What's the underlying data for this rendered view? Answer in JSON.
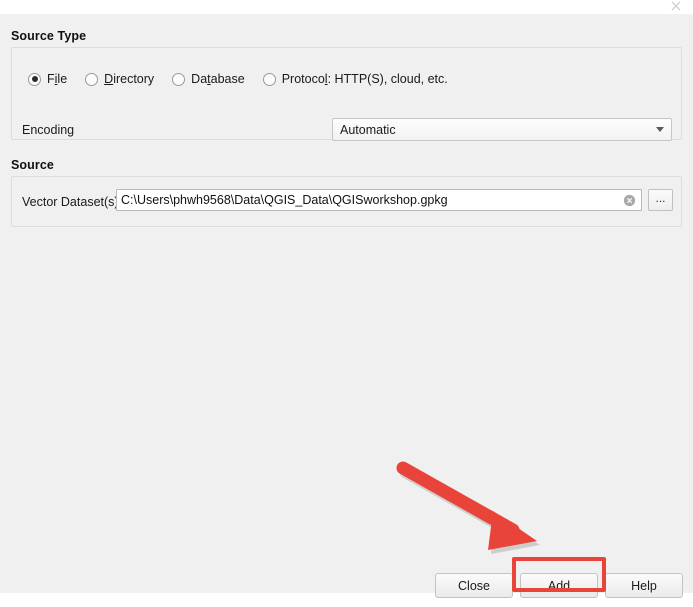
{
  "window": {
    "close_icon": "close-icon"
  },
  "source_type": {
    "title": "Source Type",
    "options": [
      {
        "label": "File",
        "mnemonic_index": 1,
        "checked": true
      },
      {
        "label": "Directory",
        "mnemonic_index": 0,
        "checked": false
      },
      {
        "label": "Database",
        "mnemonic_index": 2,
        "checked": false
      },
      {
        "label": "Protocol: HTTP(S), cloud, etc.",
        "mnemonic_index": 7,
        "checked": false
      }
    ],
    "encoding": {
      "label": "Encoding",
      "value": "Automatic",
      "arrow_icon": "chevron-down-icon"
    }
  },
  "source": {
    "title": "Source",
    "vector_dataset": {
      "label": "Vector Dataset(s)",
      "value": "C:\\Users\\phwh9568\\Data\\QGIS_Data\\QGISworkshop.gpkg",
      "placeholder": "",
      "clear_icon": "clear-circle-x-icon",
      "browse_label": "..."
    }
  },
  "buttons": {
    "close": {
      "label": "Close"
    },
    "add": {
      "label": "Add",
      "mnemonic_index": 0,
      "highlighted": true
    },
    "help": {
      "label": "Help"
    }
  },
  "annotations": {
    "arrow_color": "#e8443a",
    "highlight_color": "#e8443a",
    "arrow_target": "add-button"
  }
}
